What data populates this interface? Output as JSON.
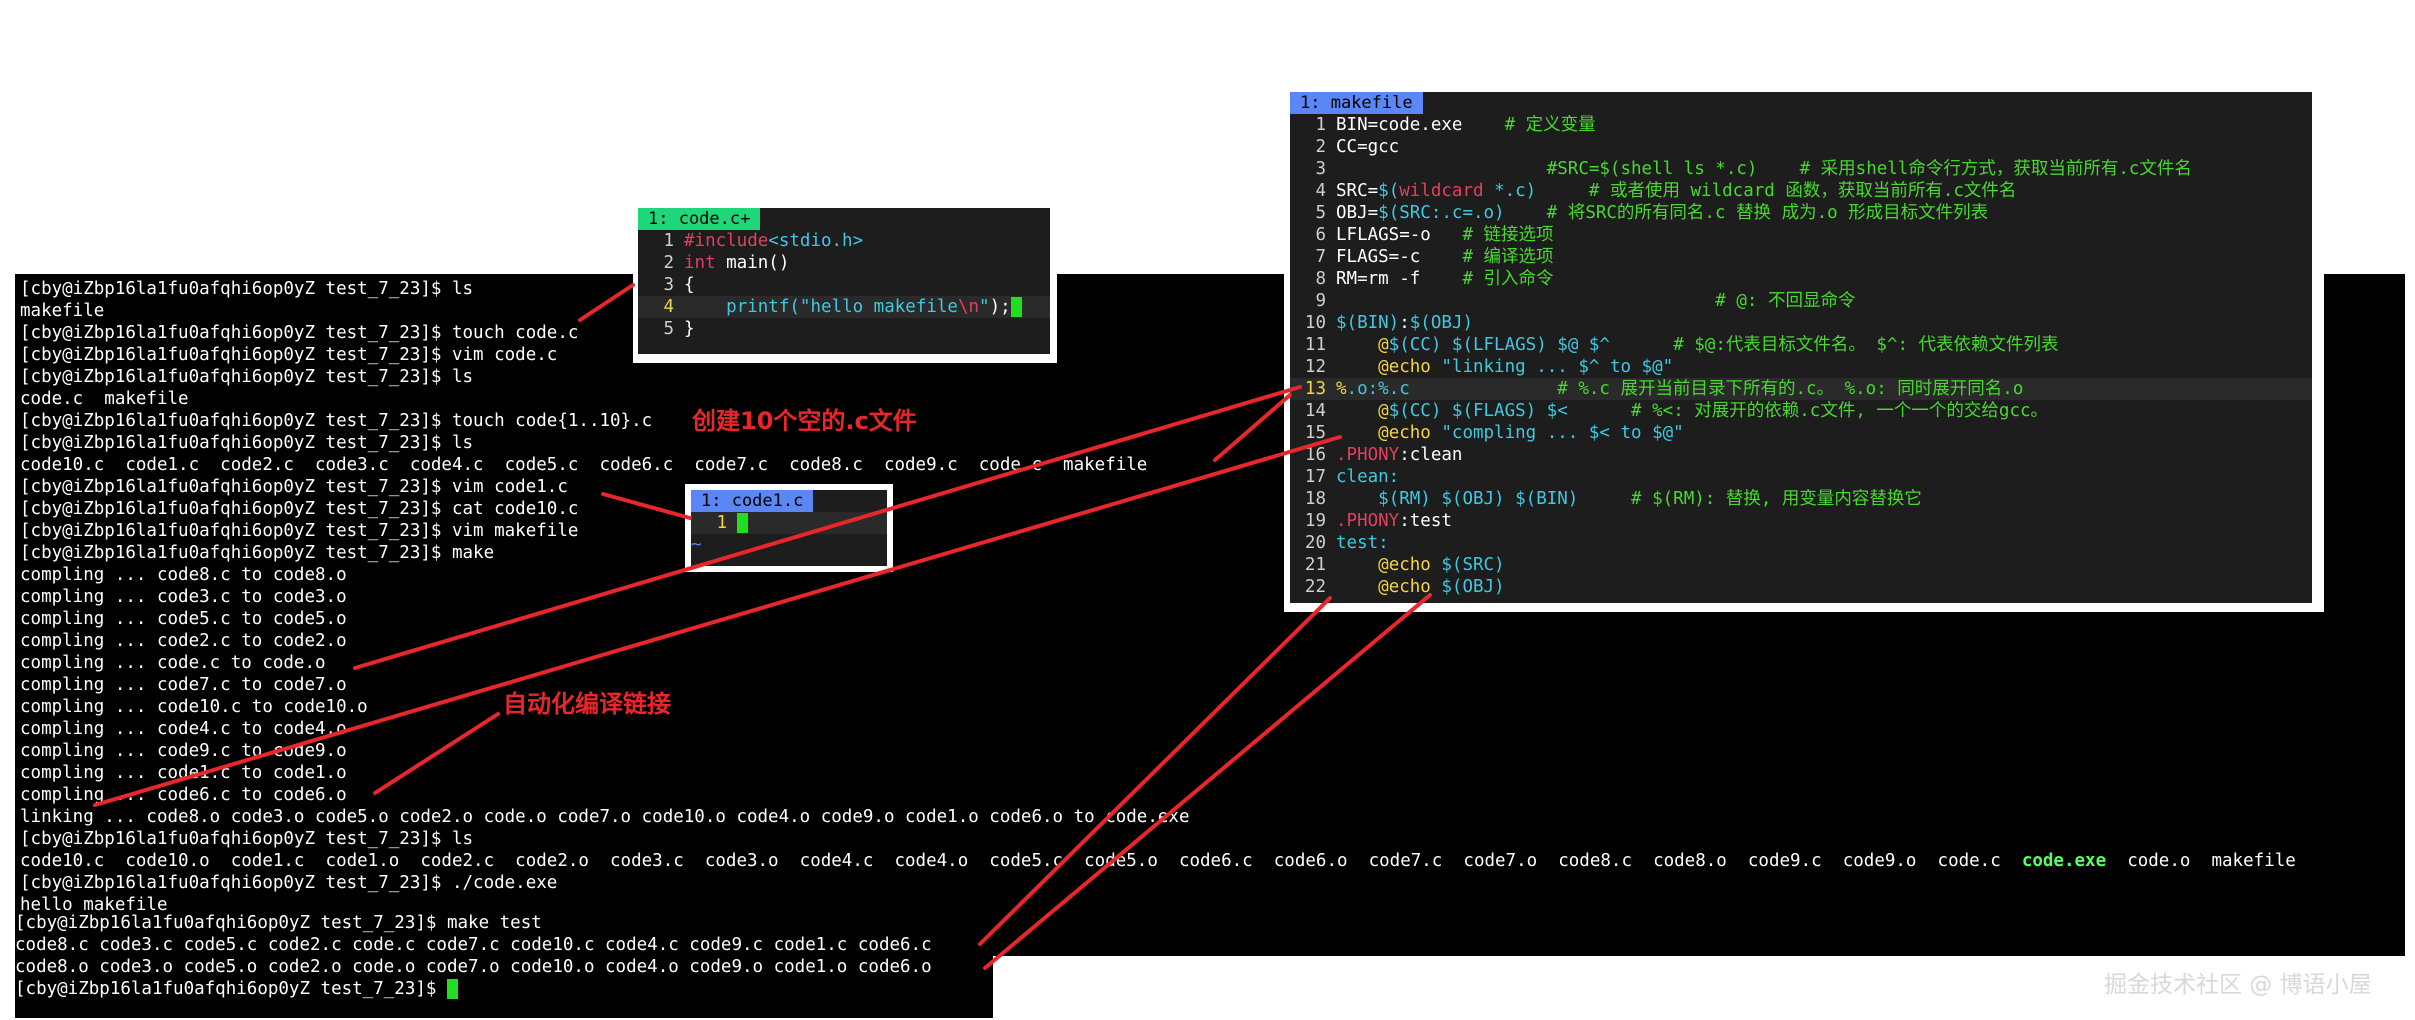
{
  "terminal": {
    "lines": [
      "[cby@iZbp16la1fu0afqhi6op0yZ test_7_23]$ ls",
      "makefile",
      "[cby@iZbp16la1fu0afqhi6op0yZ test_7_23]$ touch code.c",
      "[cby@iZbp16la1fu0afqhi6op0yZ test_7_23]$ vim code.c",
      "[cby@iZbp16la1fu0afqhi6op0yZ test_7_23]$ ls",
      "code.c  makefile",
      "[cby@iZbp16la1fu0afqhi6op0yZ test_7_23]$ touch code{1..10}.c",
      "[cby@iZbp16la1fu0afqhi6op0yZ test_7_23]$ ls",
      "code10.c  code1.c  code2.c  code3.c  code4.c  code5.c  code6.c  code7.c  code8.c  code9.c  code.c  makefile",
      "[cby@iZbp16la1fu0afqhi6op0yZ test_7_23]$ vim code1.c",
      "[cby@iZbp16la1fu0afqhi6op0yZ test_7_23]$ cat code10.c",
      "[cby@iZbp16la1fu0afqhi6op0yZ test_7_23]$ vim makefile",
      "[cby@iZbp16la1fu0afqhi6op0yZ test_7_23]$ make",
      "compling ... code8.c to code8.o",
      "compling ... code3.c to code3.o",
      "compling ... code5.c to code5.o",
      "compling ... code2.c to code2.o",
      "compling ... code.c to code.o",
      "compling ... code7.c to code7.o",
      "compling ... code10.c to code10.o",
      "compling ... code4.c to code4.o",
      "compling ... code9.c to code9.o",
      "compling ... code1.c to code1.o",
      "compling ... code6.c to code6.o",
      "linking ... code8.o code3.o code5.o code2.o code.o code7.o code10.o code4.o code9.o code1.o code6.o to code.exe",
      "[cby@iZbp16la1fu0afqhi6op0yZ test_7_23]$ ls"
    ],
    "ls_before": "code10.c  code10.o  code1.c  code1.o  code2.c  code2.o  code3.c  code3.o  code4.c  code4.o  code5.c  code5.o  code6.c  code6.o  code7.c  code7.o  code8.c  code8.o  code9.c  code9.o  code.c  ",
    "ls_exe": "code.exe",
    "ls_after": "  code.o  makefile",
    "tail_lines": [
      "[cby@iZbp16la1fu0afqhi6op0yZ test_7_23]$ ./code.exe",
      "hello makefile"
    ],
    "bottom_lines": [
      "[cby@iZbp16la1fu0afqhi6op0yZ test_7_23]$ make test",
      "code8.c code3.c code5.c code2.c code.c code7.c code10.c code4.c code9.c code1.c code6.c",
      "code8.o code3.o code5.o code2.o code.o code7.o code10.o code4.o code9.o code1.o code6.o"
    ],
    "final_prompt": "[cby@iZbp16la1fu0afqhi6op0yZ test_7_23]$ "
  },
  "vim_code": {
    "tab": "1: code.c+",
    "tab_color": "#1fd67a",
    "lines": [
      {
        "n": "1",
        "parts": [
          {
            "c": "kw",
            "t": "#include"
          },
          {
            "c": "str",
            "t": "<stdio.h>"
          }
        ]
      },
      {
        "n": "2",
        "parts": [
          {
            "c": "kw",
            "t": "int"
          },
          {
            "c": "var",
            "t": " main()"
          }
        ]
      },
      {
        "n": "3",
        "parts": [
          {
            "c": "var",
            "t": "{"
          }
        ]
      },
      {
        "n": "4",
        "parts": [
          {
            "c": "var",
            "t": "    "
          },
          {
            "c": "str",
            "t": "printf("
          },
          {
            "c": "str",
            "t": "\"hello makefile"
          },
          {
            "c": "kw",
            "t": "\\n"
          },
          {
            "c": "str",
            "t": "\""
          },
          {
            "c": "var",
            "t": ");"
          }
        ]
      },
      {
        "n": "5",
        "parts": [
          {
            "c": "var",
            "t": "}"
          }
        ]
      }
    ]
  },
  "vim_code1": {
    "tab": "1: code1.c",
    "tab_color": "#5b86f5",
    "line_number": "1",
    "tilde": "~"
  },
  "vim_makefile": {
    "tab": "1: makefile",
    "tab_color": "#5b86f5",
    "lines": [
      {
        "n": "1",
        "parts": [
          {
            "c": "var",
            "t": "BIN=code.exe    "
          },
          {
            "c": "cmt",
            "t": "# 定义变量"
          }
        ]
      },
      {
        "n": "2",
        "parts": [
          {
            "c": "var",
            "t": "CC=gcc"
          }
        ]
      },
      {
        "n": "3",
        "parts": [
          {
            "c": "var",
            "t": "                    "
          },
          {
            "c": "cmt",
            "t": "#SRC=$(shell ls *.c)    # 采用shell命令行方式，获取当前所有.c文件名"
          }
        ]
      },
      {
        "n": "4",
        "parts": [
          {
            "c": "var",
            "t": "SRC="
          },
          {
            "c": "cyan",
            "t": "$("
          },
          {
            "c": "pink",
            "t": "wildcard"
          },
          {
            "c": "cyan",
            "t": " *.c)"
          },
          {
            "c": "var",
            "t": "     "
          },
          {
            "c": "cmt",
            "t": "# 或者使用 wildcard 函数，获取当前所有.c文件名"
          }
        ]
      },
      {
        "n": "5",
        "parts": [
          {
            "c": "var",
            "t": "OBJ="
          },
          {
            "c": "cyan",
            "t": "$(SRC:.c=.o)"
          },
          {
            "c": "var",
            "t": "    "
          },
          {
            "c": "cmt",
            "t": "# 将SRC的所有同名.c 替换 成为.o 形成目标文件列表"
          }
        ]
      },
      {
        "n": "6",
        "parts": [
          {
            "c": "var",
            "t": "LFLAGS=-o   "
          },
          {
            "c": "cmt",
            "t": "# 链接选项"
          }
        ]
      },
      {
        "n": "7",
        "parts": [
          {
            "c": "var",
            "t": "FLAGS=-c    "
          },
          {
            "c": "cmt",
            "t": "# 编译选项"
          }
        ]
      },
      {
        "n": "8",
        "parts": [
          {
            "c": "var",
            "t": "RM=rm -f    "
          },
          {
            "c": "cmt",
            "t": "# 引入命令"
          }
        ]
      },
      {
        "n": "9",
        "parts": [
          {
            "c": "var",
            "t": "                                    "
          },
          {
            "c": "cmt",
            "t": "# @: 不回显命令"
          }
        ]
      },
      {
        "n": "10",
        "parts": [
          {
            "c": "cyan",
            "t": "$(BIN)"
          },
          {
            "c": "var",
            "t": ":"
          },
          {
            "c": "cyan",
            "t": "$(OBJ)"
          }
        ]
      },
      {
        "n": "11",
        "parts": [
          {
            "c": "var",
            "t": "    "
          },
          {
            "c": "yel",
            "t": "@"
          },
          {
            "c": "cyan",
            "t": "$(CC) $(LFLAGS) $@ $^"
          },
          {
            "c": "var",
            "t": "      "
          },
          {
            "c": "cmt",
            "t": "# $@:代表目标文件名。 $^: 代表依赖文件列表"
          }
        ]
      },
      {
        "n": "12",
        "parts": [
          {
            "c": "var",
            "t": "    "
          },
          {
            "c": "yel",
            "t": "@echo"
          },
          {
            "c": "cyan",
            "t": " \"linking ... $^ to $@\""
          }
        ]
      },
      {
        "n": "13",
        "parts": [
          {
            "c": "yel",
            "t": "%"
          },
          {
            "c": "cyan",
            "t": ".o:%.c"
          },
          {
            "c": "var",
            "t": "              "
          },
          {
            "c": "cmt",
            "t": "# %.c 展开当前目录下所有的.c。 %.o: 同时展开同名.o"
          }
        ]
      },
      {
        "n": "14",
        "parts": [
          {
            "c": "var",
            "t": "    "
          },
          {
            "c": "yel",
            "t": "@"
          },
          {
            "c": "cyan",
            "t": "$(CC) $(FLAGS) $<"
          },
          {
            "c": "var",
            "t": "      "
          },
          {
            "c": "cmt",
            "t": "# %<: 对展开的依赖.c文件, 一个一个的交给gcc。"
          }
        ]
      },
      {
        "n": "15",
        "parts": [
          {
            "c": "var",
            "t": "    "
          },
          {
            "c": "yel",
            "t": "@echo"
          },
          {
            "c": "cyan",
            "t": " \"compling ... $< to $@\""
          }
        ]
      },
      {
        "n": "16",
        "parts": [
          {
            "c": "pink",
            "t": ".PHONY"
          },
          {
            "c": "var",
            "t": ":clean"
          }
        ]
      },
      {
        "n": "17",
        "parts": [
          {
            "c": "cyan",
            "t": "clean:"
          }
        ]
      },
      {
        "n": "18",
        "parts": [
          {
            "c": "var",
            "t": "    "
          },
          {
            "c": "cyan",
            "t": "$(RM) $(OBJ) $(BIN)"
          },
          {
            "c": "var",
            "t": "     "
          },
          {
            "c": "cmt",
            "t": "# $(RM): 替换, 用变量内容替换它"
          }
        ]
      },
      {
        "n": "19",
        "parts": [
          {
            "c": "pink",
            "t": ".PHONY"
          },
          {
            "c": "var",
            "t": ":test"
          }
        ]
      },
      {
        "n": "20",
        "parts": [
          {
            "c": "cyan",
            "t": "test:"
          }
        ]
      },
      {
        "n": "21",
        "parts": [
          {
            "c": "var",
            "t": "    "
          },
          {
            "c": "yel",
            "t": "@echo"
          },
          {
            "c": "cyan",
            "t": " $(SRC)"
          }
        ]
      },
      {
        "n": "22",
        "parts": [
          {
            "c": "var",
            "t": "    "
          },
          {
            "c": "yel",
            "t": "@echo"
          },
          {
            "c": "cyan",
            "t": " $(OBJ)"
          }
        ]
      }
    ]
  },
  "annotations": {
    "create_files": "创建10个空的.c文件",
    "auto_compile": "自动化编译链接"
  },
  "colors": {
    "annotation": "#e8262b",
    "cursor": "#22dd22",
    "exe": "#55ff66"
  },
  "watermark": "掘金技术社区 @ 博语小屋"
}
